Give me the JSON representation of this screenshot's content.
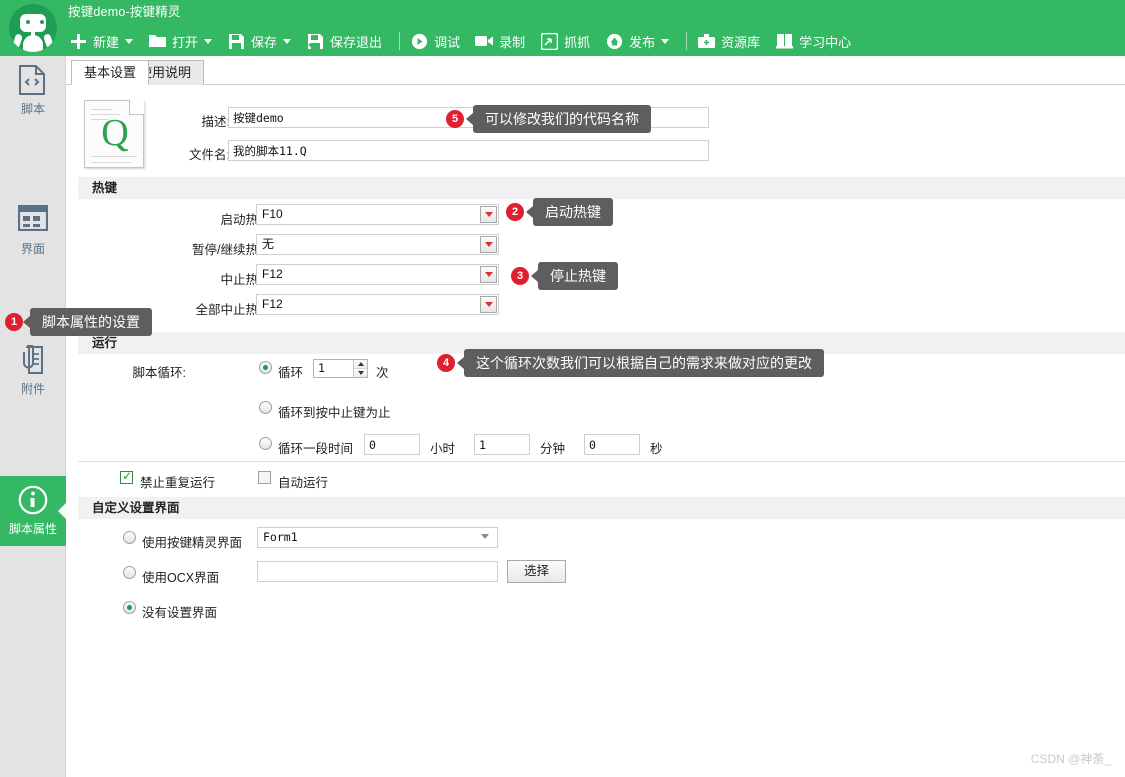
{
  "window": {
    "app_title": "按键demo-按键精灵",
    "logo_icon": "robot-icon"
  },
  "toolbar": {
    "items": [
      {
        "label": "新建",
        "icon": "plus-icon",
        "caret": true
      },
      {
        "label": "打开",
        "icon": "folder-icon",
        "caret": true
      },
      {
        "label": "保存",
        "icon": "save-icon",
        "caret": true
      },
      {
        "label": "保存退出",
        "icon": "save-exit-icon",
        "caret": false
      },
      {
        "label": "调试",
        "icon": "play-icon",
        "caret": false
      },
      {
        "label": "录制",
        "icon": "video-icon",
        "caret": false
      },
      {
        "label": "抓抓",
        "icon": "capture-icon",
        "caret": false
      },
      {
        "label": "发布",
        "icon": "publish-icon",
        "caret": true
      },
      {
        "label": "资源库",
        "icon": "briefcase-icon",
        "caret": false
      },
      {
        "label": "学习中心",
        "icon": "book-icon",
        "caret": false
      }
    ]
  },
  "sidebar": {
    "items": [
      {
        "label": "脚本",
        "icon": "code-file-icon",
        "active": false
      },
      {
        "label": "界面",
        "icon": "window-grid-icon",
        "active": false
      },
      {
        "label": "附件",
        "icon": "attachment-icon",
        "active": false
      },
      {
        "label": "脚本属性",
        "icon": "info-icon",
        "active": true
      }
    ]
  },
  "tabs": [
    {
      "label": "基本设置",
      "active": true
    },
    {
      "label": "使用说明",
      "active": false
    }
  ],
  "basic": {
    "desc_label": "描述:",
    "desc_value": "按键demo",
    "filename_label": "文件名:",
    "filename_value": "我的脚本11.Q",
    "file_icon": "q-document-icon"
  },
  "hotkey": {
    "section_title": "热键",
    "rows": [
      {
        "label": "启动热键:",
        "value": "F10"
      },
      {
        "label": "暂停/继续热键:",
        "value": "无"
      },
      {
        "label": "中止热键:",
        "value": "F12"
      },
      {
        "label": "全部中止热键:",
        "value": "F12"
      }
    ]
  },
  "run": {
    "section_title": "运行",
    "loop_label": "脚本循环:",
    "opt_count": {
      "label": "循环",
      "value": "1",
      "unit": "次",
      "selected": true
    },
    "opt_until_stop": {
      "label": "循环到按中止键为止",
      "selected": false
    },
    "opt_duration": {
      "label": "循环一段时间",
      "selected": false,
      "hours": "0",
      "hours_unit": "小时",
      "minutes": "1",
      "minutes_unit": "分钟",
      "seconds": "0",
      "seconds_unit": "秒"
    },
    "no_repeat": {
      "label": "禁止重复运行",
      "checked": true
    },
    "auto_run": {
      "label": "自动运行",
      "checked": false
    }
  },
  "custom_ui": {
    "section_title": "自定义设置界面",
    "opt_builtin": {
      "label": "使用按键精灵界面",
      "selected": false,
      "combo_value": "Form1"
    },
    "opt_ocx": {
      "label": "使用OCX界面",
      "selected": false,
      "input_value": "",
      "button_label": "选择"
    },
    "opt_none": {
      "label": "没有设置界面",
      "selected": true
    }
  },
  "annotations": [
    {
      "number": "1",
      "text": "脚本属性的设置"
    },
    {
      "number": "2",
      "text": "启动热键"
    },
    {
      "number": "3",
      "text": "停止热键"
    },
    {
      "number": "4",
      "text": "这个循环次数我们可以根据自己的需求来做对应的更改"
    },
    {
      "number": "5",
      "text": "可以修改我们的代码名称"
    }
  ],
  "watermark": "CSDN @神荼_",
  "colors": {
    "brand_green": "#35b863",
    "logo_green": "#1f9d55",
    "badge_red": "#e0202e",
    "callout_gray": "#5e5e5e"
  }
}
